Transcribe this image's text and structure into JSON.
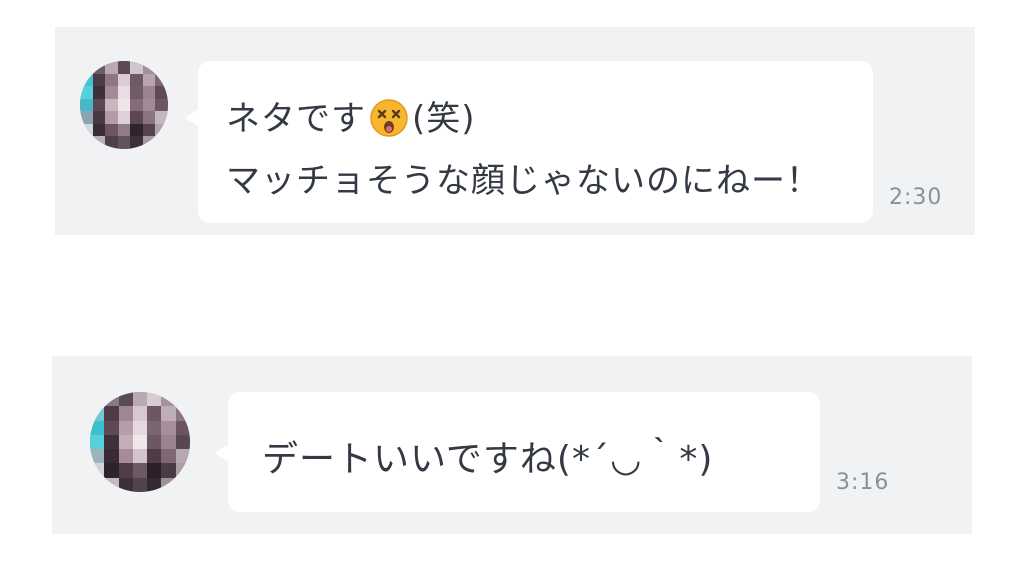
{
  "messages": [
    {
      "line1_text": "ネタです",
      "emoji": "dizzy-face-emoji",
      "line1_suffix": "(笑)",
      "line2_text": "マッチョそうな顔じゃないのにねー！",
      "time": "2:30",
      "avatar": "blurred-avatar"
    },
    {
      "line1_text": "デートいいですね(*´◡｀*)",
      "time": "3:16",
      "avatar": "blurred-avatar"
    }
  ],
  "colors": {
    "panel_bg": "#f1f2f4",
    "bubble_bg": "#ffffff",
    "text": "#333a44",
    "timestamp": "#8b9099"
  }
}
